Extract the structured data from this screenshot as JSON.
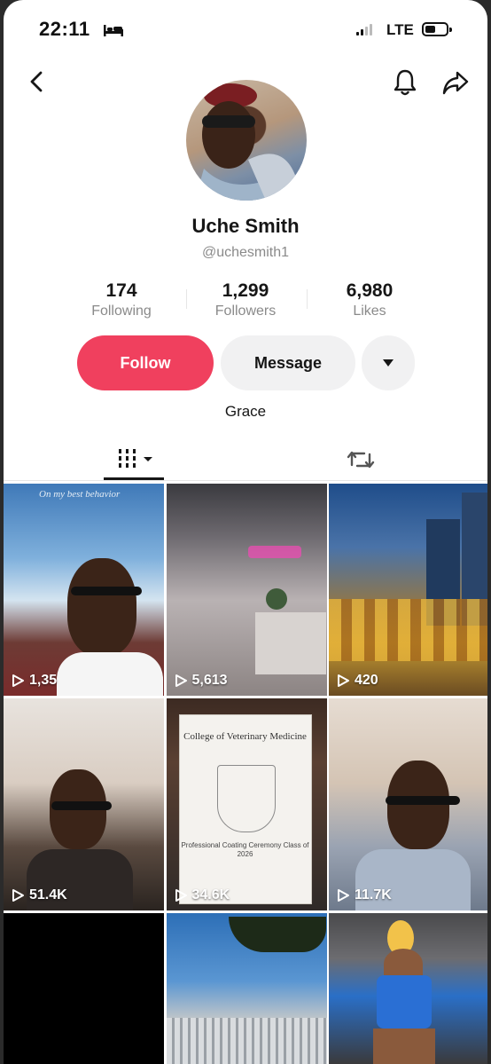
{
  "status_bar": {
    "time": "22:11",
    "network": "LTE"
  },
  "profile": {
    "name": "Uche Smith",
    "handle": "@uchesmith1",
    "bio": "Grace",
    "stats": [
      {
        "value": "174",
        "label": "Following"
      },
      {
        "value": "1,299",
        "label": "Followers"
      },
      {
        "value": "6,980",
        "label": "Likes"
      }
    ]
  },
  "actions": {
    "follow_label": "Follow",
    "message_label": "Message"
  },
  "tabs": [
    {
      "icon": "videos-grid-icon",
      "active": true
    },
    {
      "icon": "repost-icon",
      "active": false
    }
  ],
  "grid": {
    "overlay_text": "On my best behavior",
    "doc_title": "College of Veterinary Medicine",
    "doc_caption": "Professional Coating Ceremony Class of 2026",
    "videos": [
      {
        "views": "1,35"
      },
      {
        "views": "5,613"
      },
      {
        "views": "420"
      },
      {
        "views": "51.4K"
      },
      {
        "views": "34.6K"
      },
      {
        "views": "11.7K"
      },
      {
        "views": ""
      },
      {
        "views": ""
      },
      {
        "views": ""
      }
    ]
  },
  "colors": {
    "follow_button": "#f0405e",
    "secondary_button": "#f1f1f2",
    "muted_text": "#8a8a8a"
  }
}
